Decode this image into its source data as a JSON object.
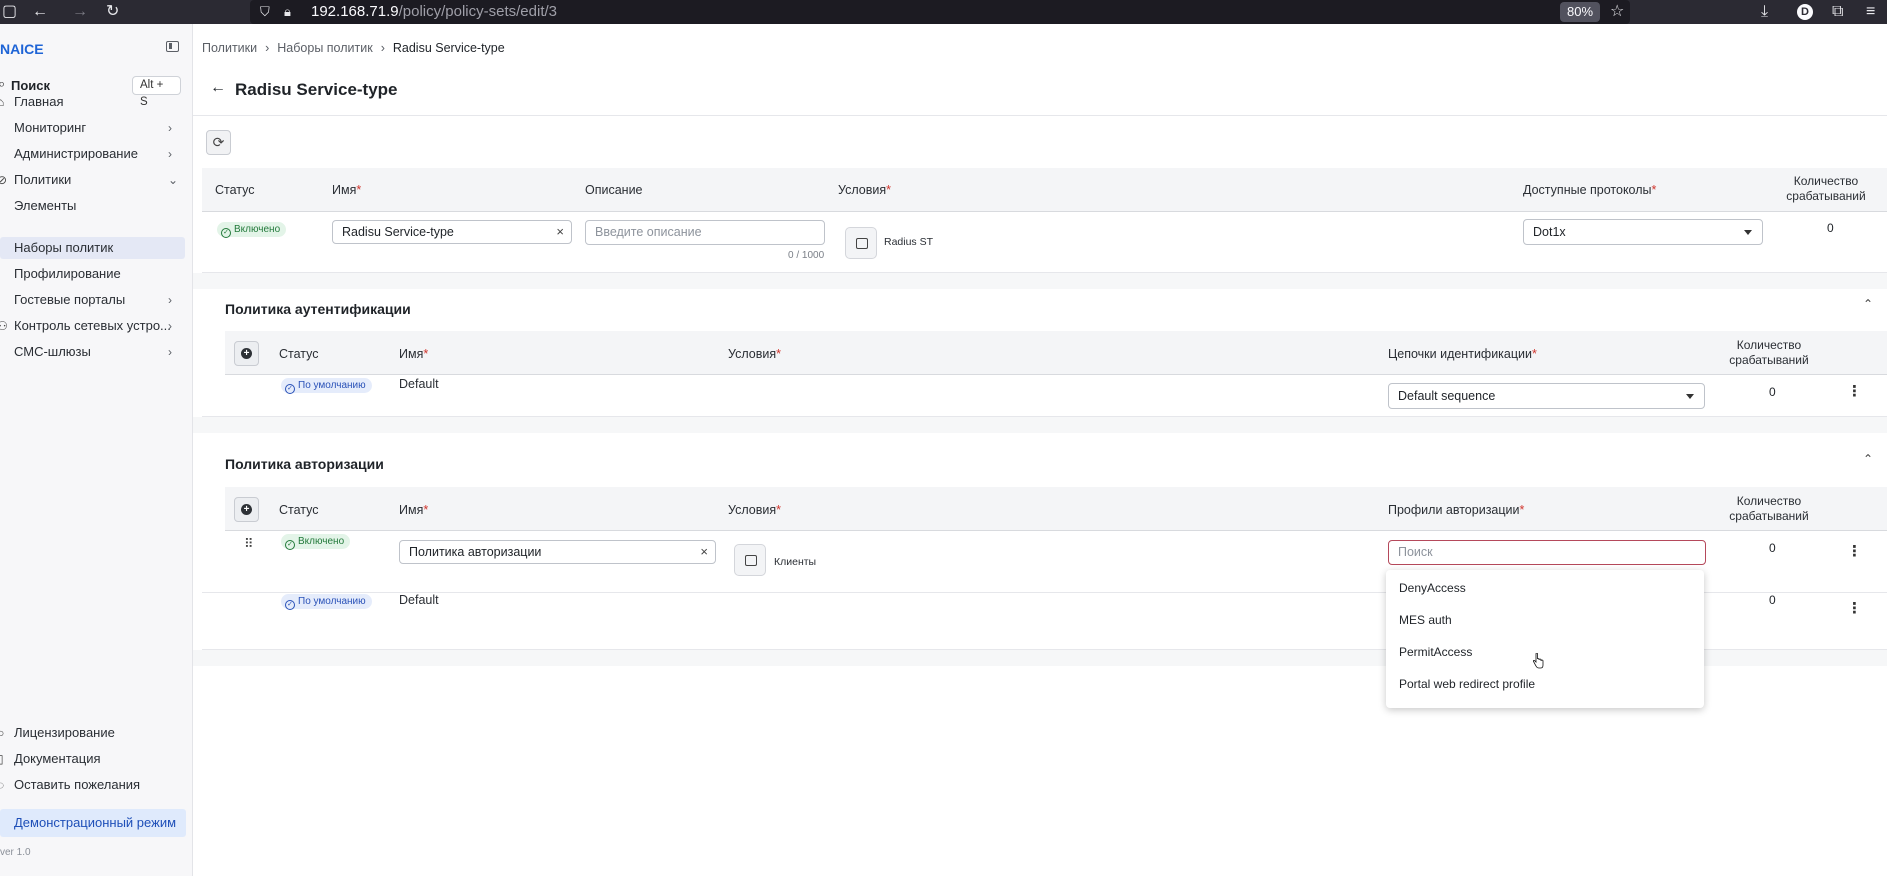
{
  "browser": {
    "url_host": "192.168.71.9",
    "url_path": "/policy/policy-sets/edit/3",
    "zoom": "80%",
    "profile_initial": "D"
  },
  "sidebar": {
    "brand": "NAICE",
    "search_label": "Поиск",
    "search_shortcut": "Alt + S",
    "items": [
      {
        "label": "Главная"
      },
      {
        "label": "Мониторинг"
      },
      {
        "label": "Администрирование"
      },
      {
        "label": "Политики"
      },
      {
        "label": "Элементы"
      },
      {
        "label": "Наборы политик"
      },
      {
        "label": "Профилирование"
      },
      {
        "label": "Гостевые порталы"
      },
      {
        "label": "Контроль сетевых устро..."
      },
      {
        "label": "СМС-шлюзы"
      }
    ],
    "bottom": [
      {
        "label": "Лицензирование"
      },
      {
        "label": "Документация"
      },
      {
        "label": "Оставить пожелания"
      }
    ],
    "demo_mode": "Демонстрационный режим",
    "version": "ver 1.0"
  },
  "breadcrumb": [
    "Политики",
    "Наборы политик",
    "Radisu Service-type"
  ],
  "page_title": "Radisu Service-type",
  "policy_set": {
    "headers": {
      "status": "Статус",
      "name": "Имя",
      "description": "Описание",
      "conditions": "Условия",
      "protocols": "Доступные протоколы",
      "count_line1": "Количество",
      "count_line2": "срабатываний"
    },
    "row": {
      "status": "Включено",
      "name": "Radisu Service-type",
      "description_placeholder": "Введите описание",
      "description_counter": "0 / 1000",
      "condition": "Radius ST",
      "protocol": "Dot1x",
      "count": "0"
    }
  },
  "auth_policy": {
    "title": "Политика аутентификации",
    "headers": {
      "status": "Статус",
      "name": "Имя",
      "conditions": "Условия",
      "chains": "Цепочки идентификации",
      "count_line1": "Количество",
      "count_line2": "срабатываний"
    },
    "rows": [
      {
        "status": "По умолчанию",
        "name": "Default",
        "chain": "Default sequence",
        "count": "0"
      }
    ]
  },
  "authz_policy": {
    "title": "Политика авторизации",
    "headers": {
      "status": "Статус",
      "name": "Имя",
      "conditions": "Условия",
      "profiles": "Профили авторизации",
      "count_line1": "Количество",
      "count_line2": "срабатываний"
    },
    "rows": [
      {
        "status": "Включено",
        "name": "Политика авторизации",
        "condition": "Клиенты",
        "profile_search_placeholder": "Поиск",
        "count": "0"
      },
      {
        "status": "По умолчанию",
        "name": "Default",
        "count": "0"
      }
    ],
    "dropdown_options": [
      "DenyAccess",
      "MES auth",
      "PermitAccess",
      "Portal web redirect profile"
    ]
  },
  "colors": {
    "accent": "#1e64d6",
    "required": "#d0342c",
    "enabled_badge": "#237a3b",
    "default_badge": "#2a52b8"
  }
}
